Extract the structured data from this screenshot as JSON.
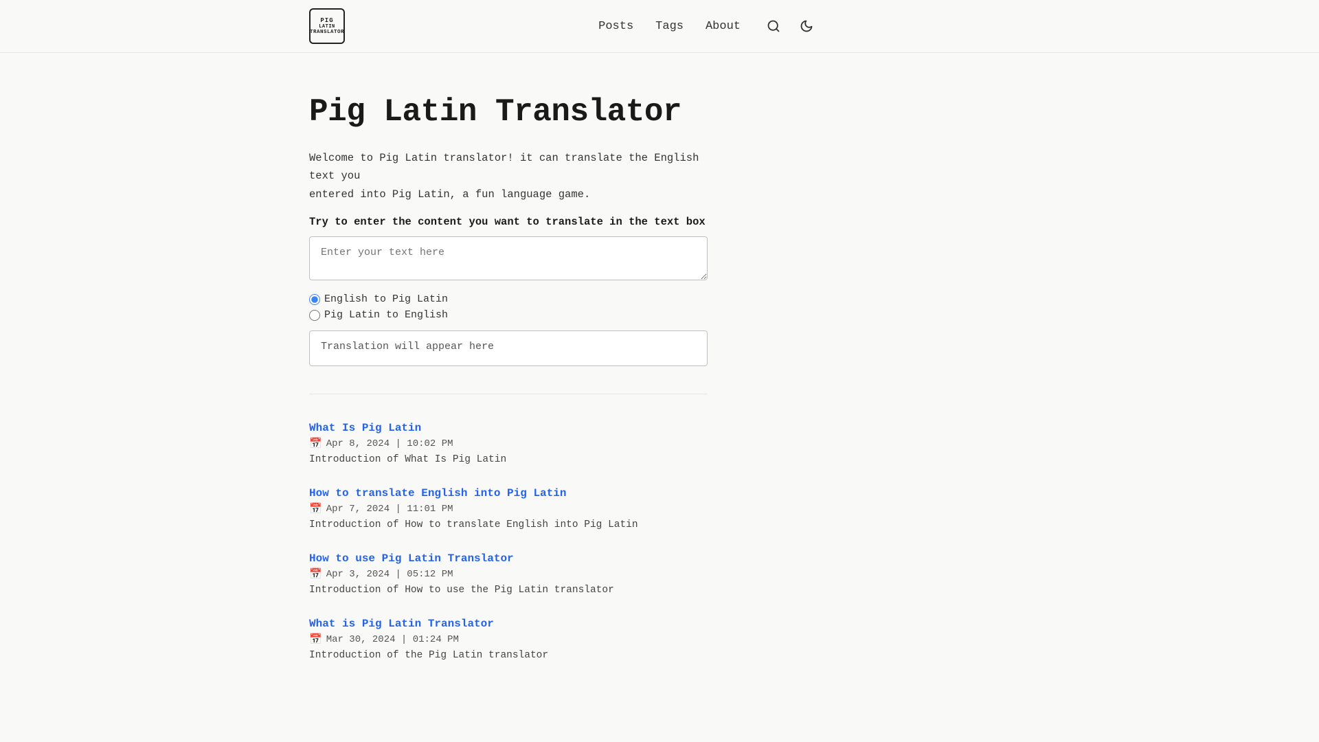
{
  "site": {
    "logo_line1": "PIG",
    "logo_line2": "LATIN",
    "logo_line3": "TRANSLATOR"
  },
  "nav": {
    "posts_label": "Posts",
    "tags_label": "Tags",
    "about_label": "About",
    "search_icon": "🔍",
    "theme_icon": "🌙"
  },
  "hero": {
    "title": "Pig Latin Translator",
    "welcome": "Welcome to Pig Latin translator! it can translate the English text you\nentered into Pig Latin, a fun language game.",
    "try_label": "Try to enter the content you want to translate in the text box",
    "input_placeholder": "Enter your text here",
    "radio_option1": "English to Pig Latin",
    "radio_option2": "Pig Latin to English",
    "translation_placeholder": "Translation will appear here"
  },
  "posts": [
    {
      "title": "What Is Pig Latin",
      "date": "Apr 8, 2024 | 10:02 PM",
      "excerpt": "Introduction of What Is Pig Latin"
    },
    {
      "title": "How to translate English into Pig Latin",
      "date": "Apr 7, 2024 | 11:01 PM",
      "excerpt": "Introduction of How to translate English into Pig Latin"
    },
    {
      "title": "How to use Pig Latin Translator",
      "date": "Apr 3, 2024 | 05:12 PM",
      "excerpt": "Introduction of How to use the Pig Latin translator"
    },
    {
      "title": "What is Pig Latin Translator",
      "date": "Mar 30, 2024 | 01:24 PM",
      "excerpt": "Introduction of the Pig Latin translator"
    }
  ]
}
